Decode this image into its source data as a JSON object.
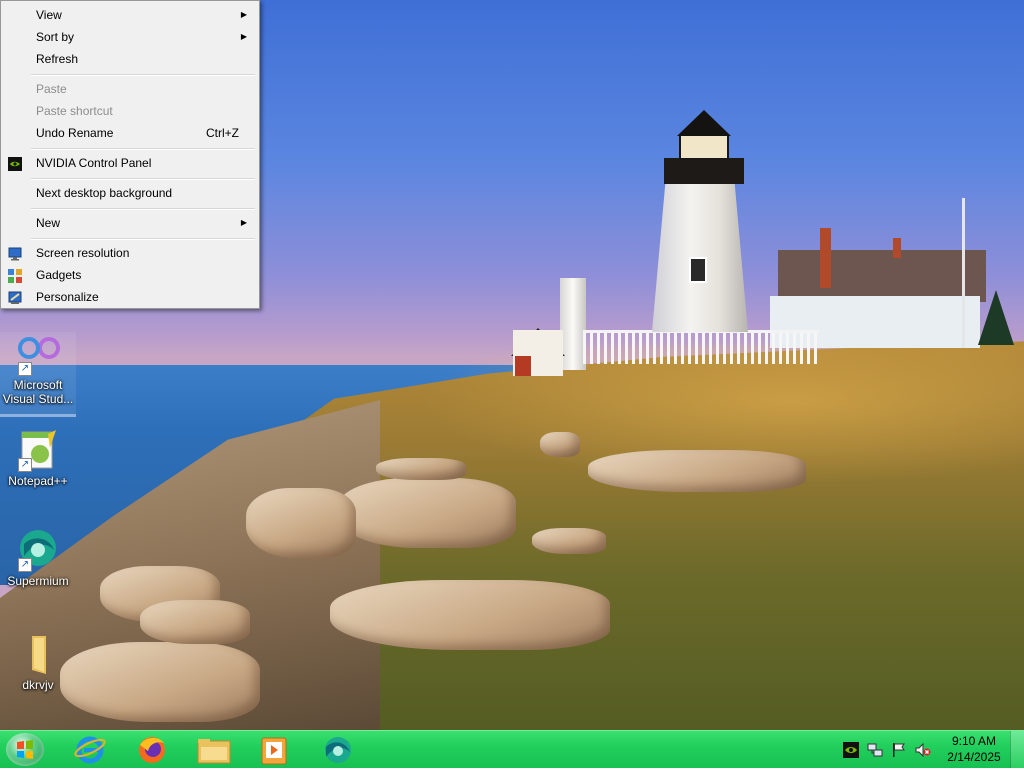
{
  "context_menu": {
    "items": [
      {
        "label": "View",
        "underline_char": "V",
        "has_submenu": true
      },
      {
        "label": "Sort by",
        "has_submenu": true
      },
      {
        "label": "Refresh"
      },
      {
        "label": "Paste",
        "disabled": true
      },
      {
        "label": "Paste shortcut",
        "disabled": true
      },
      {
        "label": "Undo Rename",
        "accelerator": "Ctrl+Z"
      },
      {
        "label": "NVIDIA Control Panel",
        "icon": "nvidia-icon"
      },
      {
        "label": "Next desktop background"
      },
      {
        "label": "New",
        "has_submenu": true
      },
      {
        "label": "Screen resolution",
        "icon": "monitor-icon"
      },
      {
        "label": "Gadgets",
        "icon": "gadgets-icon"
      },
      {
        "label": "Personalize",
        "icon": "personalize-icon"
      }
    ],
    "submenu_glyph": "▶"
  },
  "desktop_icons": [
    {
      "label_line1": "Microsoft",
      "label_line2": "Visual Stud...",
      "icon": "visual-studio-icon",
      "selected": true
    },
    {
      "label_line1": "Notepad++",
      "label_line2": "",
      "icon": "notepad-plus-plus-icon"
    },
    {
      "label_line1": "Supermium",
      "label_line2": "",
      "icon": "supermium-icon"
    },
    {
      "label_line1": "dkrvjv",
      "label_line2": "",
      "icon": "folder-icon"
    }
  ],
  "shortcut_arrow": "↗",
  "taskbar": {
    "pinned": [
      "internet-explorer-icon",
      "firefox-icon",
      "file-explorer-icon",
      "media-player-icon",
      "supermium-icon"
    ],
    "tray_icons": [
      "nvidia-tray-icon",
      "network-icon",
      "action-center-flag-icon",
      "volume-muted-icon"
    ],
    "clock_time": "9:10 AM",
    "clock_date": "2/14/2025",
    "color": "#22cf5d"
  }
}
